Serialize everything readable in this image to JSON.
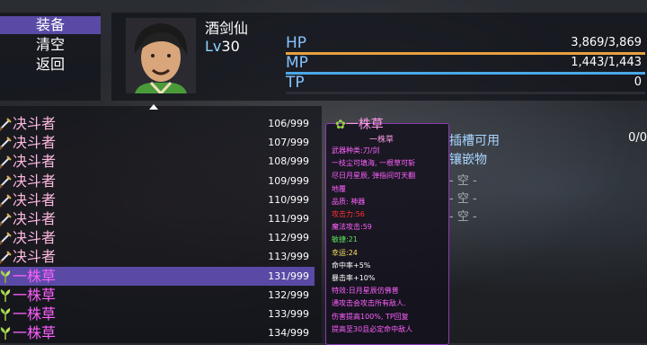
{
  "menu": {
    "items": [
      "装备",
      "清空",
      "返回"
    ],
    "selected_index": 0
  },
  "actor": {
    "name": "酒剑仙",
    "level_label": "Lv",
    "level": "30",
    "hp": {
      "label": "HP",
      "value": "3,869/3,869",
      "ratio": 1.0,
      "color": "#e8a040"
    },
    "mp": {
      "label": "MP",
      "value": "1,443/1,443",
      "ratio": 1.0,
      "color": "#4aa8e8"
    },
    "tp": {
      "label": "TP",
      "value": "0",
      "ratio": 0.0,
      "color": "#5ac05a"
    }
  },
  "items": [
    {
      "icon": "sword-icon",
      "name": "决斗者",
      "count": "106/999",
      "color": "#ffb8e0"
    },
    {
      "icon": "sword-icon",
      "name": "决斗者",
      "count": "107/999",
      "color": "#ffb8e0"
    },
    {
      "icon": "sword-icon",
      "name": "决斗者",
      "count": "108/999",
      "color": "#ffb8e0"
    },
    {
      "icon": "sword-icon",
      "name": "决斗者",
      "count": "109/999",
      "color": "#ffb8e0"
    },
    {
      "icon": "sword-icon",
      "name": "决斗者",
      "count": "110/999",
      "color": "#ffb8e0"
    },
    {
      "icon": "sword-icon",
      "name": "决斗者",
      "count": "111/999",
      "color": "#ffb8e0"
    },
    {
      "icon": "sword-icon",
      "name": "决斗者",
      "count": "112/999",
      "color": "#ffb8e0"
    },
    {
      "icon": "sword-icon",
      "name": "决斗者",
      "count": "113/999",
      "color": "#ffb8e0"
    },
    {
      "icon": "herb-icon",
      "name": "一株草",
      "count": "131/999",
      "color": "#ff60ff",
      "selected": true
    },
    {
      "icon": "herb-icon",
      "name": "一株草",
      "count": "132/999",
      "color": "#ff60ff"
    },
    {
      "icon": "herb-icon",
      "name": "一株草",
      "count": "133/999",
      "color": "#ff60ff"
    },
    {
      "icon": "herb-icon",
      "name": "一株草",
      "count": "134/999",
      "color": "#ff60ff"
    }
  ],
  "tooltip": {
    "title": "一株草",
    "subtitle": "一株草",
    "lines": [
      {
        "text": "武器种类:刀/剑",
        "color": "#ff60ff"
      },
      {
        "text": "一枝尘可填海, 一根草可斩",
        "color": "#ff60ff"
      },
      {
        "text": "尽日月星辰, 弹指间可天翻",
        "color": "#ff60ff"
      },
      {
        "text": "地覆",
        "color": "#ff60ff"
      },
      {
        "text": "品质: 神器",
        "color": "#ff60ff"
      },
      {
        "text": "攻击力:56",
        "color": "#ff3030"
      },
      {
        "text": "魔法攻击:59",
        "color": "#ff60ff"
      },
      {
        "text": "敏捷:21",
        "color": "#60e060"
      },
      {
        "text": "幸运:24",
        "color": "#ffe060"
      },
      {
        "text": "命中率+5%",
        "color": "#ffffff"
      },
      {
        "text": "暴击率+10%",
        "color": "#ffffff"
      },
      {
        "text": "特效:日月星辰仿佛普",
        "color": "#ff60ff"
      },
      {
        "text": "通攻击会攻击所有敌人.",
        "color": "#ff60ff"
      },
      {
        "text": "伤害提高100%, TP回复",
        "color": "#ff60ff"
      },
      {
        "text": "提高至30且必定命中敌人",
        "color": "#ff60ff"
      }
    ]
  },
  "slots": {
    "title_line1": "插槽可用",
    "title_line2": "镶嵌物",
    "count": "0/0",
    "empty": [
      "- 空 -",
      "- 空 -",
      "- 空 -"
    ]
  }
}
